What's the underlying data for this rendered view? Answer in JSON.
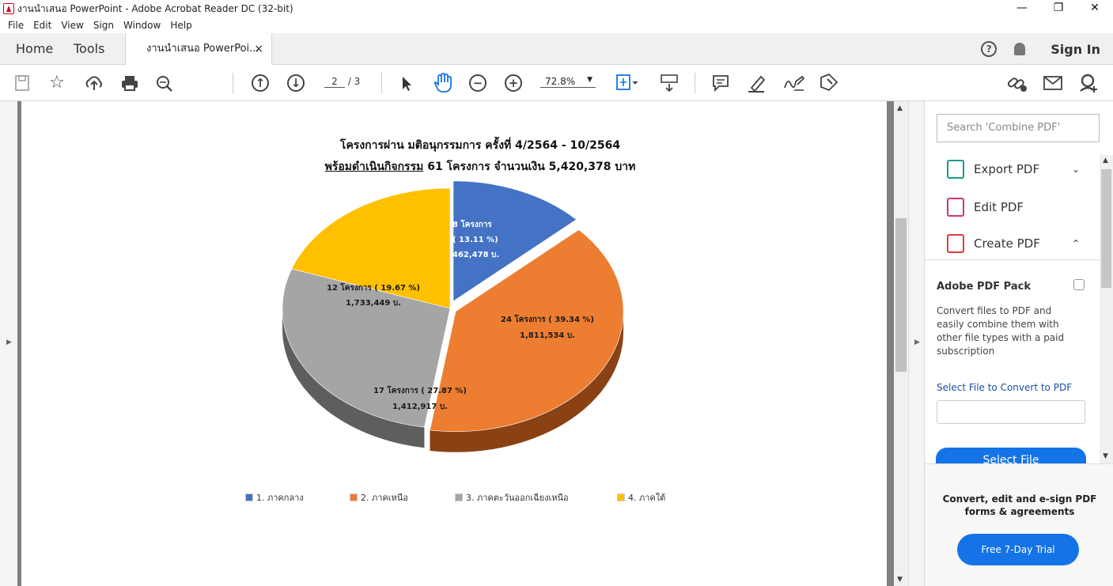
{
  "window": {
    "title": "งานนำเสนอ PowerPoint - Adobe Acrobat Reader DC (32-bit)",
    "minimize": "—",
    "maximize": "❐",
    "close": "✕"
  },
  "menu": [
    "File",
    "Edit",
    "View",
    "Sign",
    "Window",
    "Help"
  ],
  "tabs": {
    "home": "Home",
    "tools": "Tools",
    "document": "งานนำเสนอ PowerPoi...",
    "document_close": "×",
    "help": "?",
    "sign_in": "Sign In"
  },
  "toolbar": {
    "current_page": "2",
    "total_pages": "/ 3",
    "zoom": "72.8%",
    "icons": [
      "save-icon",
      "bookmark-star-icon",
      "upload-cloud-icon",
      "print-icon",
      "zoom-search-icon",
      "page-up-icon",
      "page-down-icon",
      "select-cursor-icon",
      "hand-icon",
      "zoom-out-icon",
      "zoom-in-icon",
      "fit-page-icon",
      "scroll-mode-icon",
      "comment-icon",
      "highlight-icon",
      "sign-icon",
      "fill-sign-icon",
      "share-link-icon",
      "email-icon",
      "account-icon"
    ]
  },
  "chart_data": {
    "type": "pie",
    "title_line1": "โครงการผ่าน มติอนุกรรมการ ครั้งที่ 4/2564 - 10/2564",
    "title_line2_underlined": "พร้อมดำเนินกิจกรรม",
    "title_line2_rest": " 61 โครงการ จำนวนเงิน 5,420,378 บาท",
    "categories": [
      "1. ภาคกลาง",
      "2. ภาคเหนือ",
      "3. ภาคตะวันออกเฉียงเหนือ",
      "4. ภาคใต้"
    ],
    "values": [
      13.11,
      39.34,
      27.87,
      19.67
    ],
    "colors": [
      "#4472c4",
      "#ed7d31",
      "#a5a5a5",
      "#ffc000"
    ],
    "side_colors": [
      "#2b4f8f",
      "#8a4215",
      "#5e5e5e",
      "#a17c00"
    ],
    "labels": [
      {
        "line1": "8 โครงการ",
        "line2": "( 13.11 %)",
        "line3": "462,478 บ."
      },
      {
        "line1": "24 โครงการ ( 39.34 %)",
        "line2": "1,811,534 บ."
      },
      {
        "line1": "17 โครงการ ( 27.87 %)",
        "line2": "1,412,917 บ."
      },
      {
        "line1": "12 โครงการ ( 19.67 %)",
        "line2": "1,733,449 บ."
      }
    ],
    "legend_placement": "bottom"
  },
  "sidebar": {
    "search_placeholder": "Search 'Combine PDF'",
    "export_pdf": "Export PDF",
    "edit_pdf": "Edit PDF",
    "create_pdf": "Create PDF",
    "export_chevron": "⌄",
    "create_chevron": "⌃",
    "pack_title": "Adobe PDF Pack",
    "pack_desc": "Convert files to PDF and easily combine them with other file types with a paid subscription",
    "convert_link": "Select File to Convert to PDF",
    "select_file": "Select File",
    "promo_text": "Convert, edit and e-sign PDF forms & agreements",
    "trial_button": "Free 7-Day Trial",
    "colors": {
      "export": "#1a9c8a",
      "edit": "#d6336c",
      "create": "#e03a3e"
    }
  }
}
